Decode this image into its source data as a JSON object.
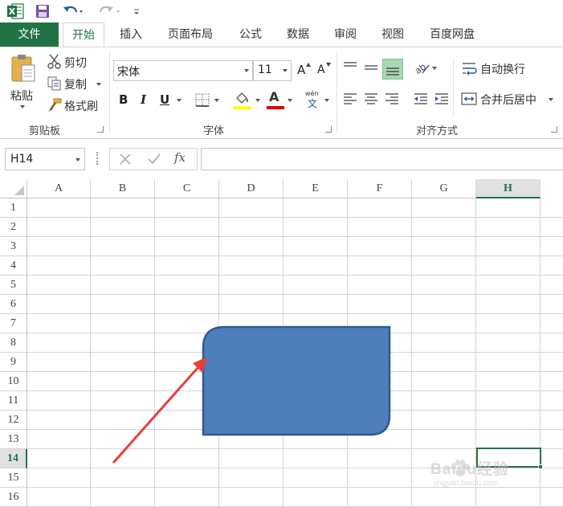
{
  "qat": {
    "excel_icon": "excel-logo-icon",
    "save_icon": "save-icon",
    "undo_icon": "undo-icon",
    "redo_icon": "redo-icon",
    "customize_icon": "customize-qat-icon"
  },
  "tabs": [
    "文件",
    "开始",
    "插入",
    "页面布局",
    "公式",
    "数据",
    "审阅",
    "视图",
    "百度网盘"
  ],
  "active_tab": "开始",
  "clipboard": {
    "paste_label": "粘贴",
    "cut_label": "剪切",
    "copy_label": "复制",
    "format_painter_label": "格式刷",
    "group_label": "剪贴板"
  },
  "font": {
    "font_name": "宋体",
    "font_size": "11",
    "grow_label": "A",
    "shrink_label": "A",
    "bold_label": "B",
    "italic_label": "I",
    "underline_label": "U",
    "font_color_label": "A",
    "phonetic_top": "wén",
    "phonetic_bottom": "文",
    "group_label": "字体",
    "highlight_color": "#ffff00",
    "font_color": "#e00000"
  },
  "alignment": {
    "wrap_text_label": "自动换行",
    "merge_center_label": "合并后居中",
    "group_label": "对齐方式",
    "active_button_color": "#a9d7b5"
  },
  "formula_bar": {
    "name_box": "H14",
    "fx_label": "fx",
    "formula_value": ""
  },
  "sheet": {
    "columns": [
      "A",
      "B",
      "C",
      "D",
      "E",
      "F",
      "G",
      "H"
    ],
    "rows": [
      "1",
      "2",
      "3",
      "4",
      "5",
      "6",
      "7",
      "8",
      "9",
      "10",
      "11",
      "12",
      "13",
      "14",
      "15",
      "16"
    ],
    "selected_column": "H",
    "selected_row": "14",
    "shape_color": "#4e7fba",
    "shape_border": "#2f5a8d",
    "arrow_color": "#e8403a",
    "accent": "#217346"
  },
  "watermark": {
    "brand": "Baidu经验",
    "url": "jingyan.baidu.com"
  }
}
